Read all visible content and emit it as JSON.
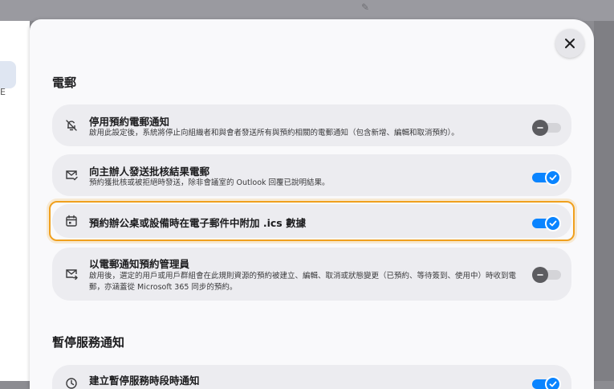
{
  "sections": [
    {
      "title": "電郵",
      "items": [
        {
          "title": "停用預約電郵通知",
          "description": "啟用此設定後，系統將停止向組織者和與會者發送所有與預約相關的電郵通知（包含新增、編輯和取消預約）。",
          "icon": "bell-off-icon",
          "enabled": false
        },
        {
          "title": "向主辦人發送批核結果電郵",
          "description": "預約獲批核或被拒絕時發送，除非會議室的 Outlook 回覆已說明結果。",
          "icon": "mail-check-icon",
          "enabled": true
        },
        {
          "title": "預約辦公桌或設備時在電子郵件中附加 .ics 數據",
          "description": "",
          "icon": "calendar-icon",
          "enabled": true
        },
        {
          "title": "以電郵通知預約管理員",
          "description": "啟用後，選定的用戶或用戶群組會在此規則資源的預約被建立、編輯、取消或狀態變更（已預約、等待簽到、使用中）時收到電郵，亦涵蓋從 Microsoft 365 同步的預約。",
          "icon": "mail-forward-icon",
          "enabled": false
        }
      ]
    },
    {
      "title": "暫停服務通知",
      "items": [
        {
          "title": "建立暫停服務時段時通知",
          "description": "",
          "icon": "clock-icon",
          "enabled": true
        }
      ]
    }
  ],
  "colors": {
    "accent": "#0a84ff",
    "focus": "#f0a01e",
    "card": "#ececf0"
  }
}
